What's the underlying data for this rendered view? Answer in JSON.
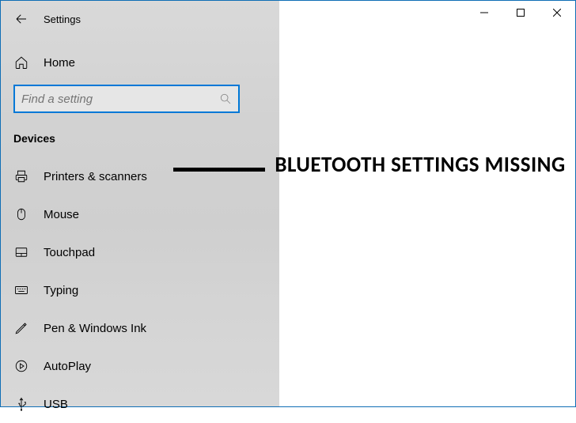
{
  "window": {
    "title": "Settings"
  },
  "sidebar": {
    "home_label": "Home",
    "search_placeholder": "Find a setting",
    "section_header": "Devices",
    "items": [
      {
        "label": "Printers & scanners",
        "icon": "printer-icon"
      },
      {
        "label": "Mouse",
        "icon": "mouse-icon"
      },
      {
        "label": "Touchpad",
        "icon": "touchpad-icon"
      },
      {
        "label": "Typing",
        "icon": "keyboard-icon"
      },
      {
        "label": "Pen & Windows Ink",
        "icon": "pen-icon"
      },
      {
        "label": "AutoPlay",
        "icon": "autoplay-icon"
      },
      {
        "label": "USB",
        "icon": "usb-icon"
      }
    ]
  },
  "annotation": {
    "text": "BLUETOOTH SETTINGS MISSING"
  }
}
